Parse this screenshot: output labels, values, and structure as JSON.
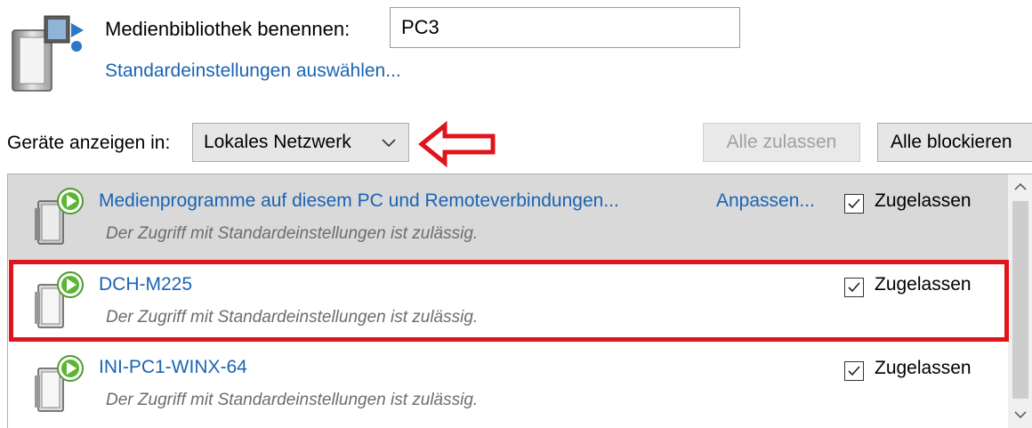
{
  "header": {
    "library_icon": "media-library-icon",
    "name_label": "Medienbibliothek benennen:",
    "name_value": "PC3",
    "defaults_link": "Standardeinstellungen auswählen..."
  },
  "toolbar": {
    "show_label": "Geräte anzeigen in:",
    "network_selected": "Lokales Netzwerk",
    "allow_all_label": "Alle zulassen",
    "allow_all_enabled": false,
    "block_all_label": "Alle blockieren"
  },
  "devices": [
    {
      "name": "Medienprogramme auf diesem PC und Remoteverbindungen...",
      "description": "Der Zugriff mit Standardeinstellungen ist zulässig.",
      "customize_label": "Anpassen...",
      "allowed_label": "Zugelassen",
      "allowed": true,
      "selected": true,
      "icon": "media-device-icon"
    },
    {
      "name": "DCH-M225",
      "description": "Der Zugriff mit Standardeinstellungen ist zulässig.",
      "allowed_label": "Zugelassen",
      "allowed": true,
      "selected": false,
      "highlighted": true,
      "icon": "media-device-icon"
    },
    {
      "name": "INI-PC1-WINX-64",
      "description": "Der Zugriff mit Standardeinstellungen ist zulässig.",
      "allowed_label": "Zugelassen",
      "allowed": true,
      "selected": false,
      "icon": "media-device-icon"
    }
  ],
  "colors": {
    "link": "#1a64b4",
    "annotation_red": "#e0151c",
    "selected_row": "#d9d9d9"
  }
}
